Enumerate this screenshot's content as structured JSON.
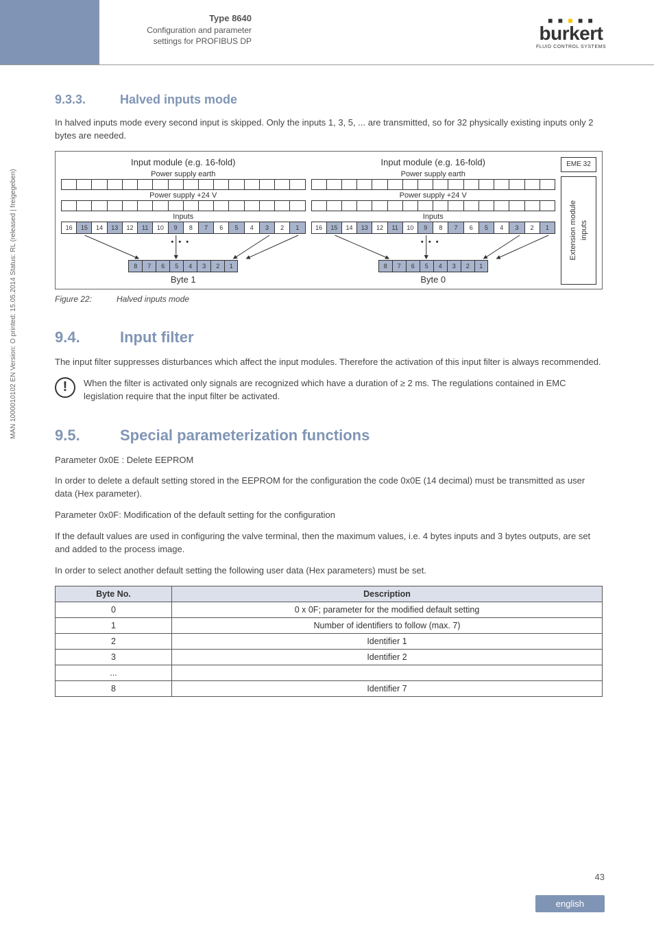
{
  "header": {
    "type_label": "Type 8640",
    "subtitle_l1": "Configuration and parameter",
    "subtitle_l2": "settings for PROFIBUS DP",
    "logo_name": "burkert",
    "logo_tag": "FLUID CONTROL SYSTEMS"
  },
  "s933": {
    "num": "9.3.3.",
    "title": "Halved inputs mode",
    "para": "In halved inputs mode every second input is skipped. Only the inputs 1, 3, 5, ... are transmitted, so for 32 physically existing inputs only 2 bytes are needed."
  },
  "diagram": {
    "mod_title": "Input module (e.g. 16-fold)",
    "row1": "Power supply earth",
    "row2": "Power supply +24 V",
    "row3": "Inputs",
    "inputs": [
      "16",
      "15",
      "14",
      "13",
      "12",
      "11",
      "10",
      "9",
      "8",
      "7",
      "6",
      "5",
      "4",
      "3",
      "2",
      "1"
    ],
    "dots": "• • •",
    "byte_cells": [
      "8",
      "7",
      "6",
      "5",
      "4",
      "3",
      "2",
      "1"
    ],
    "byte1": "Byte 1",
    "byte0": "Byte 0",
    "eme": "EME 32",
    "ext1": "Extension module",
    "ext2": "inputs"
  },
  "fig": {
    "num": "Figure 22:",
    "cap": "Halved inputs mode"
  },
  "s94": {
    "num": "9.4.",
    "title": "Input filter",
    "para": "The input filter suppresses disturbances which affect the input modules. Therefore the activation of this input filter is always recommended.",
    "note": "When the filter is activated only signals are recognized which have a duration of ≥ 2 ms. The regulations contained in EMC legislation require that the input filter be activated."
  },
  "s95": {
    "num": "9.5.",
    "title": "Special parameterization functions",
    "p1": "Parameter 0x0E : Delete EEPROM",
    "p2": "In order to delete a default setting stored in the EEPROM for the configuration the code 0x0E (14 decimal) must be transmitted as user data (Hex parameter).",
    "p3": "Parameter 0x0F: Modification of the default setting for the configuration",
    "p4": "If the default values are used in configuring the valve terminal, then the maximum values, i.e. 4 bytes inputs and 3 bytes outputs, are set and added to the process image.",
    "p5": "In order to select another default setting the following user data (Hex parameters) must be set."
  },
  "table": {
    "h1": "Byte No.",
    "h2": "Description",
    "rows": [
      {
        "b": "0",
        "d": "0 x 0F; parameter for the modified default setting"
      },
      {
        "b": "1",
        "d": "Number of identifiers to follow (max. 7)"
      },
      {
        "b": "2",
        "d": "Identifier 1"
      },
      {
        "b": "3",
        "d": "Identifier 2"
      },
      {
        "b": "...",
        "d": ""
      },
      {
        "b": "8",
        "d": "Identifier 7"
      }
    ]
  },
  "side_text": "MAN 1000010102 EN Version: O  printed: 15.05.2014 Status: RL (released | freigegeben)",
  "page_num": "43",
  "footer": "english"
}
